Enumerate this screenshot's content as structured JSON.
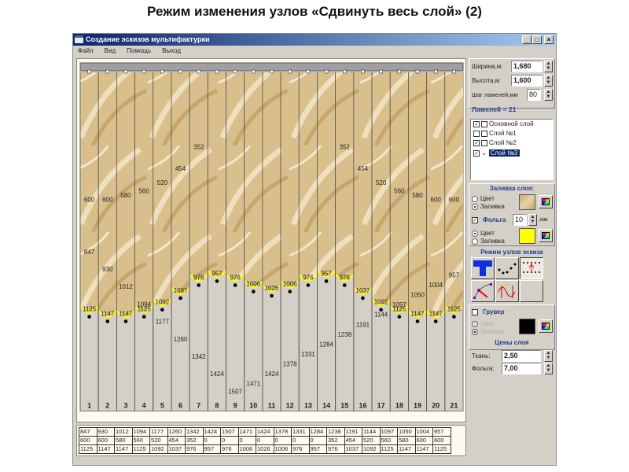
{
  "slide_title": "Режим изменения узлов «Сдвинуть весь слой» (2)",
  "window": {
    "title": "Создание эскизов мультифактурки",
    "min": "_",
    "max": "□",
    "close": "×"
  },
  "menu": [
    "Файл",
    "Вид",
    "Помощь",
    "Выход"
  ],
  "params": {
    "width_label": "Ширина,м:",
    "width_value": "1,680",
    "height_label": "Высота,м",
    "height_value": "1,600",
    "step_label": "Шаг ламелей,мм",
    "step_value": "80",
    "count_text": "Ламелей = 21"
  },
  "layers": [
    {
      "name": "Основной слой",
      "visible": true
    },
    {
      "name": "Слой №1",
      "visible": false
    },
    {
      "name": "Слой №2",
      "visible": true
    },
    {
      "name": "Слой №3",
      "visible": true,
      "selected": true
    }
  ],
  "fill": {
    "header": "Заливка слоя:",
    "color_label": "Цвет",
    "fill_label": "Заливка",
    "selected": "fill"
  },
  "foil": {
    "label": "Фольга",
    "checked": true,
    "value": "10",
    "unit": ",мм",
    "color_label": "Цвет",
    "fill_label": "Заливка",
    "selected": "color",
    "color": "#ffff00"
  },
  "node_mode": {
    "header": "Режим узлов эскиза",
    "tools": [
      "fill-tool",
      "nodes-curve-tool",
      "shift-layer-tool",
      "bezier-tool",
      "move-nodes-tool",
      ""
    ]
  },
  "gruver": {
    "label": "Грувер",
    "checked": false,
    "color_label": "Цвет",
    "fill_label": "Заливка",
    "color": "#000000"
  },
  "prices": {
    "header": "Цены слоя",
    "fabric_label": "Ткань:",
    "fabric_value": "2,50",
    "foil_label": "Фольга:",
    "foil_value": "7,00"
  },
  "sketch": {
    "height_mm": 1600,
    "numbers": [
      "1",
      "2",
      "3",
      "4",
      "5",
      "6",
      "7",
      "8",
      "9",
      "10",
      "11",
      "12",
      "13",
      "14",
      "15",
      "16",
      "17",
      "18",
      "19",
      "20",
      "21"
    ],
    "row1": [
      847,
      930,
      1012,
      1094,
      1177,
      1260,
      1342,
      1424,
      1507,
      1471,
      1424,
      1378,
      1331,
      1284,
      1238,
      1191,
      1144,
      1097,
      1050,
      1004,
      957
    ],
    "row2": [
      600,
      600,
      580,
      560,
      520,
      454,
      352,
      0,
      0,
      0,
      0,
      0,
      0,
      0,
      352,
      454,
      520,
      560,
      580,
      600,
      600
    ],
    "row3": [
      1125,
      1147,
      1147,
      1125,
      1092,
      1037,
      976,
      957,
      976,
      1006,
      1026,
      1006,
      976,
      957,
      976,
      1037,
      1092,
      1125,
      1147,
      1147,
      1125
    ]
  }
}
